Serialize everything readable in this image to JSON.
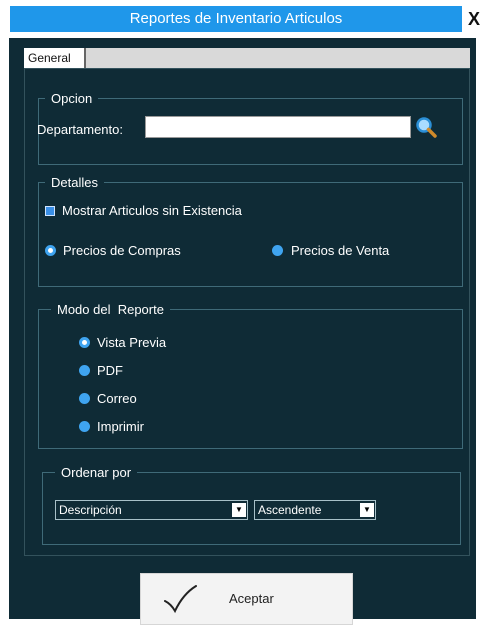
{
  "window": {
    "title": "Reportes de Inventario Articulos",
    "close_glyph": "X"
  },
  "tabs": [
    {
      "label": "General"
    }
  ],
  "opcion": {
    "legend": "Opcion",
    "departamento_label": "Departamento:",
    "departamento_value": "",
    "search_icon": "search-icon"
  },
  "detalles": {
    "legend": "Detalles",
    "checkbox_label": "Mostrar Articulos sin Existencia",
    "checkbox_checked": true,
    "radio_compras": "Precios de Compras",
    "radio_venta": "Precios de Venta",
    "selected": "Precios de Compras"
  },
  "modo": {
    "legend": "Modo del  Reporte",
    "options": [
      "Vista Previa",
      "PDF",
      "Correo",
      "Imprimir"
    ],
    "selected": "Vista Previa"
  },
  "ordenar": {
    "legend": "Ordenar por",
    "field_value": "Descripción",
    "order_value": "Ascendente"
  },
  "footer": {
    "accept_label": "Aceptar",
    "accept_icon": "checkmark-icon"
  },
  "colors": {
    "background": "#0f2b36",
    "title_bar": "#1f97ea",
    "accent": "#3fa4f0"
  }
}
